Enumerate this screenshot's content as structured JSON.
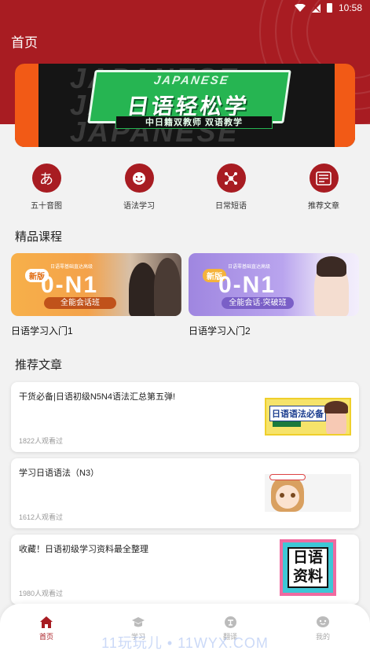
{
  "status_bar": {
    "time": "10:58"
  },
  "header": {
    "title": "首页"
  },
  "banner": {
    "bg_text": "JAPANESE",
    "en": "JAPANESE",
    "title": "日语轻松学",
    "subtitle": "中日籍双教师 双语教学"
  },
  "nav": [
    {
      "label": "五十音图",
      "icon": "hiragana-a-icon",
      "glyph": "あ"
    },
    {
      "label": "语法学习",
      "icon": "smiley-icon"
    },
    {
      "label": "日常短语",
      "icon": "network-icon"
    },
    {
      "label": "推荐文章",
      "icon": "article-icon"
    }
  ],
  "sections": {
    "courses": "精品课程",
    "articles": "推荐文章"
  },
  "courses": [
    {
      "title": "日语学习入门1",
      "badge": "新版",
      "line": "日语零基础直达高级",
      "level": "0-N1",
      "pill": "全能会话班",
      "accent": "#e98a20"
    },
    {
      "title": "日语学习入门2",
      "badge": "新版",
      "line": "日语零基础直达高级",
      "level": "0-N1",
      "pill": "全能会话·突破班",
      "accent": "#8b6fd3"
    }
  ],
  "articles": [
    {
      "title": "干货必备|日语初级N5N4语法汇总第五弹!",
      "views": "1822人观看过",
      "thumb_text": "日语语法必备"
    },
    {
      "title": "学习日语语法（N3）",
      "views": "1612人观看过",
      "thumb_text": ""
    },
    {
      "title": "收藏！日语初级学习资料最全整理",
      "views": "1980人观看过",
      "thumb_text": "日语资料"
    }
  ],
  "tabs": [
    {
      "label": "首页",
      "icon": "home-icon",
      "active": true
    },
    {
      "label": "学习",
      "icon": "graduation-cap-icon",
      "active": false
    },
    {
      "label": "翻译",
      "icon": "translate-icon",
      "active": false
    },
    {
      "label": "我的",
      "icon": "profile-icon",
      "active": false
    }
  ],
  "watermark": "11玩玩儿 • 11WYX.COM",
  "colors": {
    "brand": "#a81c22",
    "background": "#f2f2f2"
  }
}
